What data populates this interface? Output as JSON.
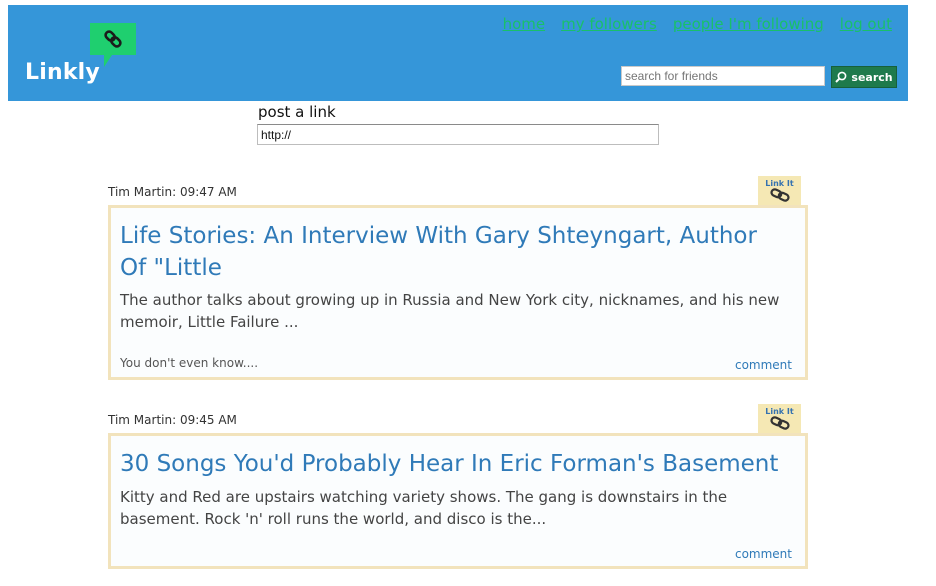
{
  "brand": {
    "name": "Linkly",
    "bubble_color": "#1fcf6f",
    "icon": "chain-link-icon"
  },
  "nav": {
    "home": "home",
    "followers": "my followers",
    "following": "people I'm following",
    "logout": "log out"
  },
  "search": {
    "placeholder": "search for friends",
    "button_label": "search",
    "button_icon": "magnifier-icon"
  },
  "post_form": {
    "label": "post a link",
    "value": "http://"
  },
  "posts": [
    {
      "meta": "Tim Martin: 09:47 AM",
      "linkit_label": "Link It",
      "title": "Life Stories: An Interview With Gary Shteyngart, Author Of \"Little",
      "description": "The author talks about growing up in Russia and New York city, nicknames, and his new memoir, Little Failure ...",
      "note": "You don't even know....",
      "comment_label": "comment"
    },
    {
      "meta": "Tim Martin: 09:45 AM",
      "linkit_label": "Link It",
      "title": "30 Songs You'd Probably Hear In Eric Forman's Basement",
      "description": "Kitty and Red are upstairs watching variety shows. The gang is downstairs in the basement. Rock 'n' roll runs the world, and disco is the...",
      "note": "",
      "comment_label": "comment"
    }
  ],
  "colors": {
    "header_bg": "#3596d9",
    "nav_link": "#19c06a",
    "title_link": "#2f7ab8",
    "card_border": "#f2e3bc",
    "linkit_bg": "#f5e8b4"
  }
}
